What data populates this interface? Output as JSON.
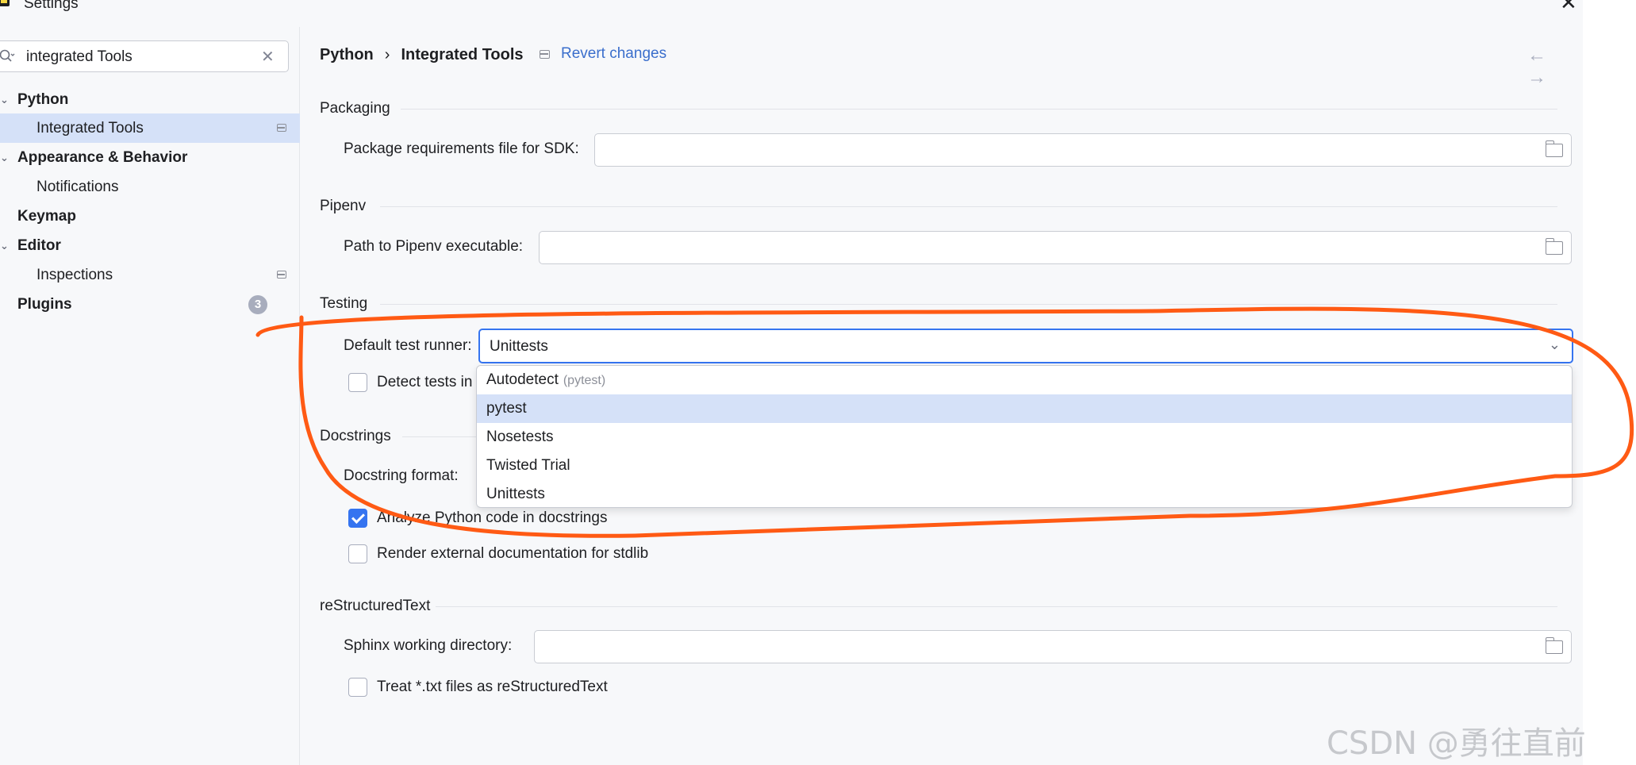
{
  "window": {
    "title": "Settings",
    "app_icon": "pycharm-icon",
    "close_icon": "close-icon"
  },
  "search": {
    "value": "integrated Tools",
    "search_icon": "search-icon",
    "clear_icon": "clear-icon"
  },
  "sidebar": {
    "items": [
      {
        "label": "Python",
        "bold": true
      },
      {
        "label": "Integrated Tools",
        "selected": true
      },
      {
        "label": "Appearance & Behavior",
        "bold": true
      },
      {
        "label": "Notifications"
      },
      {
        "label": "Keymap",
        "bold": true
      },
      {
        "label": "Editor",
        "bold": true
      },
      {
        "label": "Inspections"
      },
      {
        "label": "Plugins",
        "bold": true,
        "badge": "3"
      }
    ]
  },
  "header": {
    "crumb1": "Python",
    "separator": "›",
    "crumb2": "Integrated Tools",
    "revert": "Revert changes",
    "nav": "← →"
  },
  "packaging": {
    "title": "Packaging",
    "sdk_label": "Package requirements file for SDK:",
    "sdk_value": ""
  },
  "pipenv": {
    "title": "Pipenv",
    "path_label": "Path to Pipenv executable:",
    "path_value": ""
  },
  "testing": {
    "title": "Testing",
    "runner_label": "Default test runner:",
    "runner_value": "Unittests",
    "detect_label": "Detect tests in",
    "options": [
      {
        "label": "Autodetect",
        "hint": "(pytest)"
      },
      {
        "label": "pytest",
        "selected": true
      },
      {
        "label": "Nosetests"
      },
      {
        "label": "Twisted Trial"
      },
      {
        "label": "Unittests"
      }
    ]
  },
  "docstrings": {
    "title": "Docstrings",
    "format_label": "Docstring format:",
    "analyze_label": "Analyze Python code in docstrings",
    "analyze_checked": true,
    "render_label": "Render external documentation for stdlib",
    "render_checked": false
  },
  "rest": {
    "title": "reStructuredText",
    "sphinx_label": "Sphinx working directory:",
    "sphinx_value": "",
    "treat_label": "Treat *.txt files as reStructuredText",
    "treat_checked": false
  },
  "watermark": "CSDN @勇往直前plus",
  "colors": {
    "accent": "#3574f0",
    "selection": "#d5e1f8",
    "annotation": "#ff5a14",
    "link": "#3a6ecc"
  }
}
